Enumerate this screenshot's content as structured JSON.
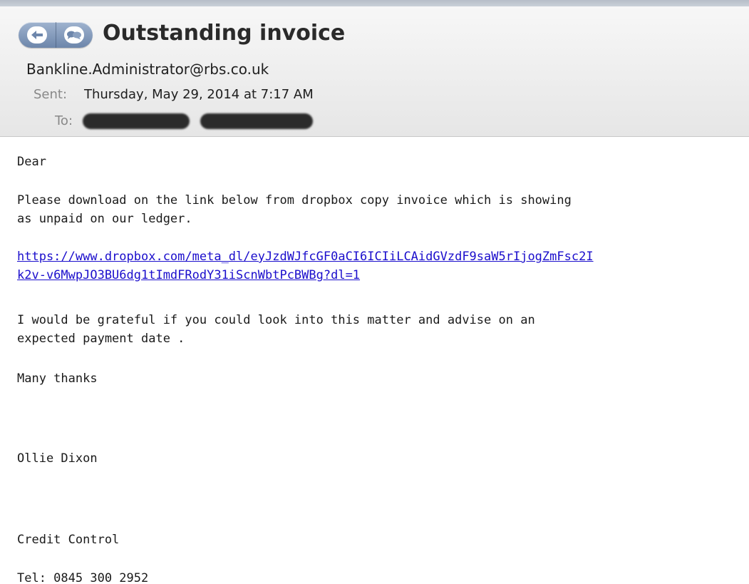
{
  "message": {
    "subject": "Outstanding invoice",
    "from": "Bankline.Administrator@rbs.co.uk",
    "sent_label": "Sent:",
    "sent_value": "Thursday, May 29, 2014 at 7:17 AM",
    "to_label": "To:"
  },
  "toolbar": {
    "back_icon": "back-arrow-icon",
    "thread_icon": "conversation-bubbles-icon"
  },
  "body": {
    "greeting": "Dear",
    "paragraph1_line1": "Please download on the link below from dropbox copy invoice which is showing",
    "paragraph1_line2": "as unpaid on our ledger.",
    "link_line1": "https://www.dropbox.com/meta_dl/eyJzdWJfcGF0aCI6ICIiLCAidGVzdF9saW5rIjogZmFsc2I",
    "link_line2": "k2v-v6MwpJO3BU6dg1tImdFRodY31iScnWbtPcBWBg?dl=1",
    "paragraph2_line1": "I would be grateful if you could look into this matter and advise on an",
    "paragraph2_line2": "expected payment date .",
    "closing": "Many thanks",
    "signature_name": "Ollie Dixon",
    "department": "Credit Control",
    "tel": "Tel: 0845 300 2952"
  },
  "colors": {
    "link": "#1a0dcc",
    "nav_pill": "#7f95b8",
    "header_bg": "#eeeeee"
  }
}
